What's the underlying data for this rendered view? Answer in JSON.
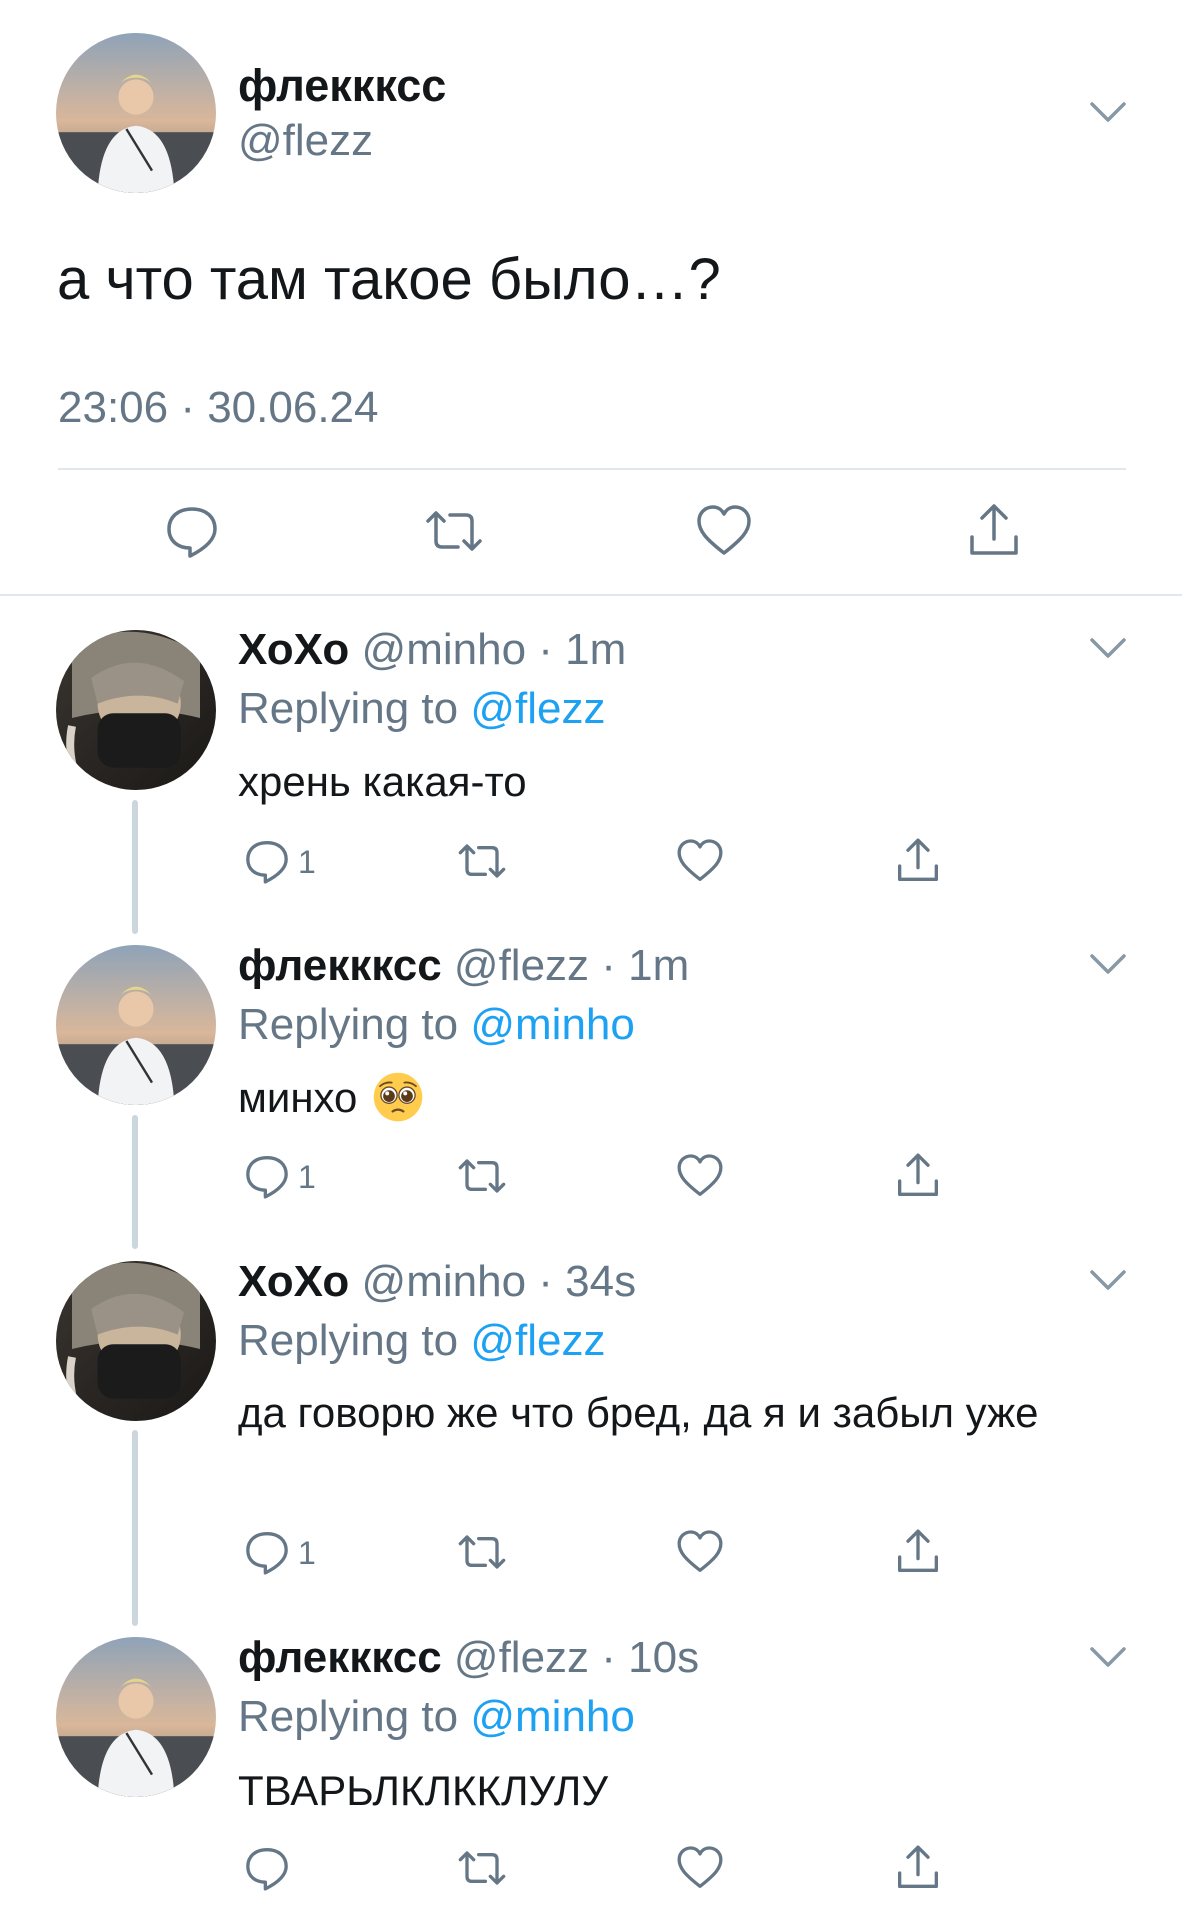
{
  "main_tweet": {
    "name": "флеккксс",
    "handle": "@flezz",
    "text": "а что там такое было…?",
    "timestamp": "23:06 · 30.06.24",
    "actions": [
      "reply-icon",
      "retweet-icon",
      "like-icon",
      "share-icon"
    ]
  },
  "replies": [
    {
      "name": "ХоХо",
      "handle": "@minho",
      "time": "1m",
      "replying_label": "Replying to ",
      "replying_to": "@flezz",
      "text": "хрень какая-то",
      "reply_count": "1"
    },
    {
      "name": "флеккксс",
      "handle": "@flezz",
      "time": "1m",
      "replying_label": "Replying to ",
      "replying_to": "@minho",
      "text": "минхо",
      "emoji": "pleading-face-emoji",
      "reply_count": "1"
    },
    {
      "name": "ХоХо",
      "handle": "@minho",
      "time": "34s",
      "replying_label": "Replying to ",
      "replying_to": "@flezz",
      "text": "да говорю же что бред, да я и забыл уже",
      "reply_count": "1"
    },
    {
      "name": "флеккксс",
      "handle": "@flezz",
      "time": "10s",
      "replying_label": "Replying to ",
      "replying_to": "@minho",
      "text": "ТВАРЬЛКЛККЛУЛУ",
      "reply_count": ""
    }
  ],
  "separator": " · ",
  "colors": {
    "text": "#14171a",
    "secondary": "#657786",
    "accent": "#1da1f2",
    "divider": "#e1e8ed",
    "thread_line": "#ccd6dd"
  }
}
